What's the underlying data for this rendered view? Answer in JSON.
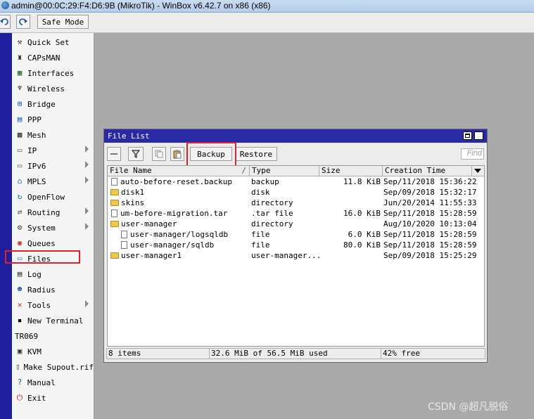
{
  "window": {
    "title": "admin@00:0C:29:F4:D6:9B (MikroTik) - WinBox v6.42.7 on x86 (x86)"
  },
  "toolbar": {
    "safe_mode_label": "Safe Mode"
  },
  "sidebar": {
    "items": [
      {
        "label": "Quick Set",
        "icon": "quick-set-icon",
        "glyph": "⚒"
      },
      {
        "label": "CAPsMAN",
        "icon": "capsman-icon",
        "glyph": "♜"
      },
      {
        "label": "Interfaces",
        "icon": "interfaces-icon",
        "glyph": "▦"
      },
      {
        "label": "Wireless",
        "icon": "wireless-icon",
        "glyph": "♆"
      },
      {
        "label": "Bridge",
        "icon": "bridge-icon",
        "glyph": "⊞"
      },
      {
        "label": "PPP",
        "icon": "ppp-icon",
        "glyph": "▤"
      },
      {
        "label": "Mesh",
        "icon": "mesh-icon",
        "glyph": "▩"
      },
      {
        "label": "IP",
        "icon": "ip-icon",
        "glyph": "▭"
      },
      {
        "label": "IPv6",
        "icon": "ipv6-icon",
        "glyph": "▭"
      },
      {
        "label": "MPLS",
        "icon": "mpls-icon",
        "glyph": "⌂"
      },
      {
        "label": "OpenFlow",
        "icon": "openflow-icon",
        "glyph": "↻"
      },
      {
        "label": "Routing",
        "icon": "routing-icon",
        "glyph": "⇄"
      },
      {
        "label": "System",
        "icon": "system-icon",
        "glyph": "⚙"
      },
      {
        "label": "Queues",
        "icon": "queues-icon",
        "glyph": "◉"
      },
      {
        "label": "Files",
        "icon": "files-icon",
        "glyph": "▭"
      },
      {
        "label": "Log",
        "icon": "log-icon",
        "glyph": "▤"
      },
      {
        "label": "Radius",
        "icon": "radius-icon",
        "glyph": "☻"
      },
      {
        "label": "Tools",
        "icon": "tools-icon",
        "glyph": "✕"
      },
      {
        "label": "New Terminal",
        "icon": "terminal-icon",
        "glyph": "▪"
      },
      {
        "label": "TR069",
        "icon": "",
        "glyph": ""
      },
      {
        "label": "KVM",
        "icon": "kvm-icon",
        "glyph": "▣"
      },
      {
        "label": "Make Supout.rif",
        "icon": "supout-icon",
        "glyph": "▯"
      },
      {
        "label": "Manual",
        "icon": "manual-icon",
        "glyph": "?"
      },
      {
        "label": "Exit",
        "icon": "exit-icon",
        "glyph": "⏻"
      }
    ]
  },
  "file_list": {
    "title": "File List",
    "backup_label": "Backup",
    "restore_label": "Restore",
    "find_placeholder": "Find",
    "columns": [
      "File Name",
      "Type",
      "Size",
      "Creation Time"
    ],
    "rows": [
      {
        "name": "auto-before-reset.backup",
        "type": "backup",
        "size": "11.8 KiB",
        "time": "Sep/11/2018 15:36:22",
        "kind": "file",
        "indent": false
      },
      {
        "name": "disk1",
        "type": "disk",
        "size": "",
        "time": "Sep/09/2018 15:32:17",
        "kind": "folder",
        "indent": false
      },
      {
        "name": "skins",
        "type": "directory",
        "size": "",
        "time": "Jun/20/2014 11:55:33",
        "kind": "folder",
        "indent": false
      },
      {
        "name": "um-before-migration.tar",
        "type": ".tar file",
        "size": "16.0 KiB",
        "time": "Sep/11/2018 15:28:59",
        "kind": "file",
        "indent": false
      },
      {
        "name": "user-manager",
        "type": "directory",
        "size": "",
        "time": "Aug/10/2020 10:13:04",
        "kind": "folder",
        "indent": false
      },
      {
        "name": "user-manager/logsqldb",
        "type": "file",
        "size": "6.0 KiB",
        "time": "Sep/11/2018 15:28:59",
        "kind": "file",
        "indent": true
      },
      {
        "name": "user-manager/sqldb",
        "type": "file",
        "size": "80.0 KiB",
        "time": "Sep/11/2018 15:28:59",
        "kind": "file",
        "indent": true
      },
      {
        "name": "user-manager1",
        "type": "user-manager...",
        "size": "",
        "time": "Sep/09/2018 15:25:29",
        "kind": "folder",
        "indent": false
      }
    ],
    "status": {
      "items": "8 items",
      "used": "32.6 MiB of 56.5 MiB used",
      "free": "42% free"
    }
  },
  "watermark": "CSDN @超凡脱俗"
}
